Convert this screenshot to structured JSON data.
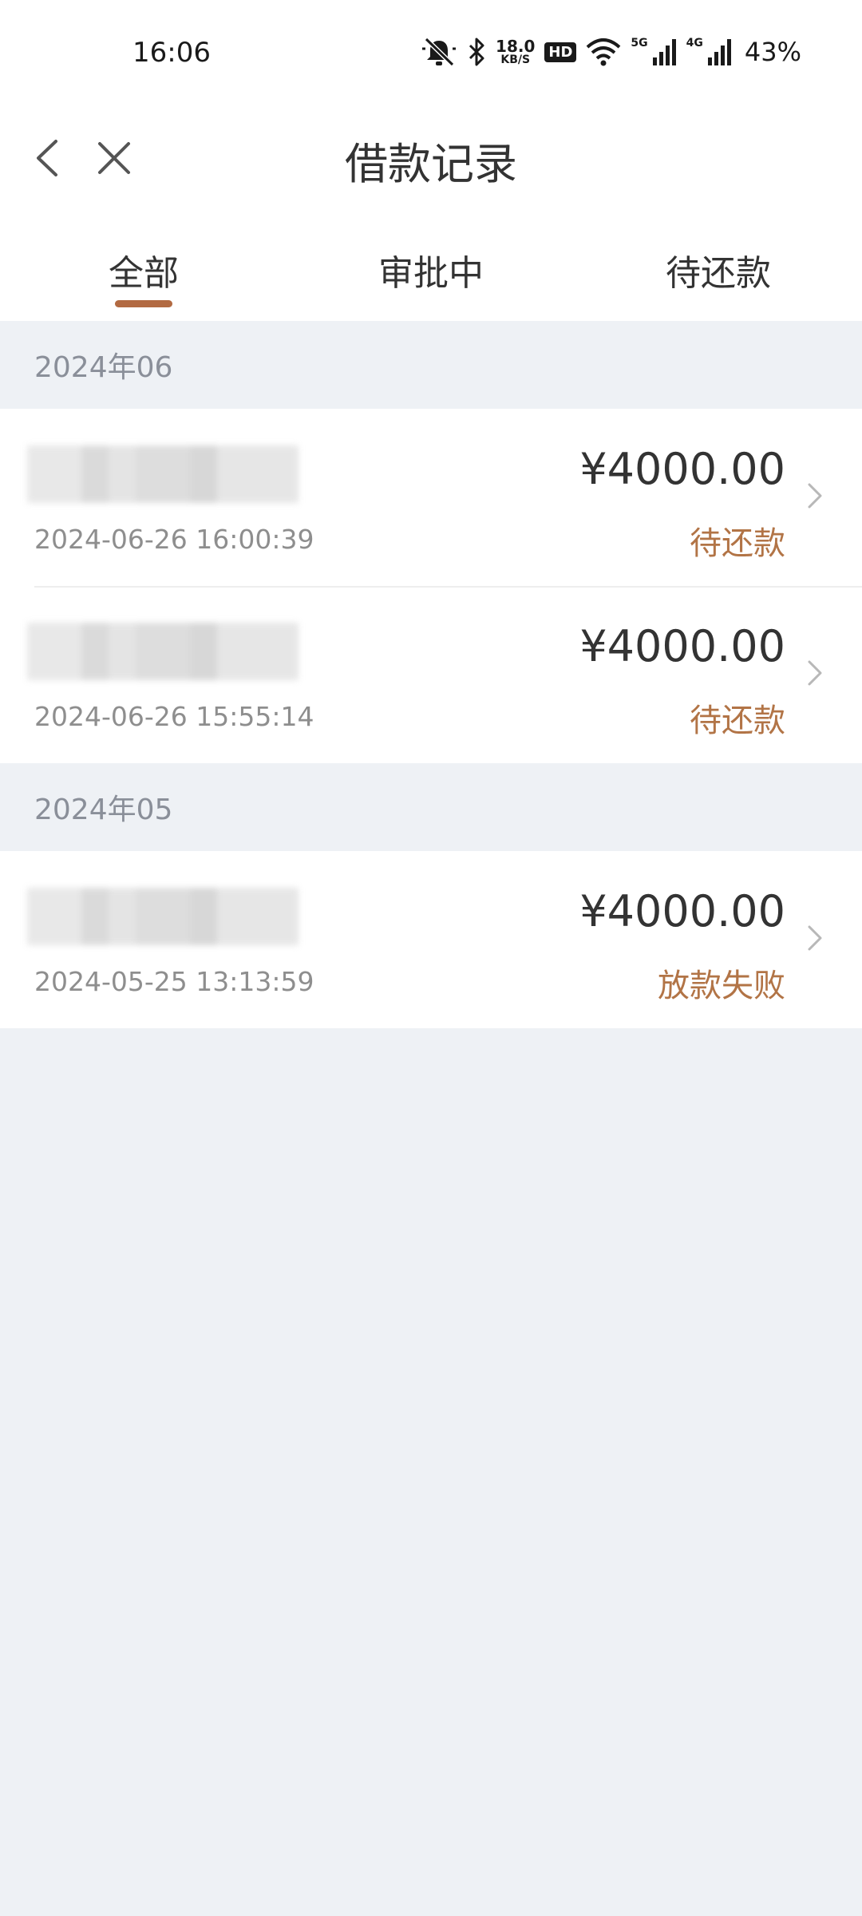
{
  "status_bar": {
    "time": "16:06",
    "speed_value": "18.0",
    "speed_unit": "KB/S",
    "hd_label": "HD",
    "net1": "5G",
    "net2": "4G",
    "battery": "43%",
    "icons": [
      "mute-icon",
      "bluetooth-icon",
      "wifi-icon",
      "signal-icon",
      "signal-icon"
    ]
  },
  "nav": {
    "title": "借款记录",
    "back_icon": "chevron-left-icon",
    "close_icon": "close-icon"
  },
  "tabs": [
    {
      "label": "全部",
      "active": true
    },
    {
      "label": "审批中",
      "active": false
    },
    {
      "label": "待还款",
      "active": false
    }
  ],
  "groups": [
    {
      "month": "2024年06",
      "records": [
        {
          "amount": "¥4000.00",
          "status": "待还款",
          "time": "2024-06-26 16:00:39"
        },
        {
          "amount": "¥4000.00",
          "status": "待还款",
          "time": "2024-06-26 15:55:14"
        }
      ]
    },
    {
      "month": "2024年05",
      "records": [
        {
          "amount": "¥4000.00",
          "status": "放款失败",
          "time": "2024-05-25 13:13:59"
        }
      ]
    }
  ],
  "colors": {
    "accent": "#b26a42",
    "status_text": "#b27446",
    "background": "#eef1f5"
  }
}
